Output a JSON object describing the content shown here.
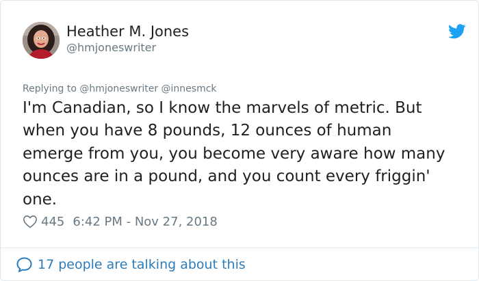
{
  "author": {
    "name": "Heather M. Jones",
    "handle": "@hmjoneswriter",
    "avatar_icon": "profile-photo"
  },
  "reply_context": "Replying to @hmjoneswriter @innesmck",
  "tweet": {
    "text": "I'm Canadian, so I know the marvels of metric. But when you have 8 pounds, 12 ounces of human emerge from you, you become very aware how many ounces are in a pound, and you count every friggin' one.",
    "likes": "445",
    "timestamp": "6:42 PM - Nov 27, 2018"
  },
  "footer": {
    "conversation": "17 people are talking about this"
  },
  "colors": {
    "twitter_blue": "#1da1f2",
    "link_blue": "#2b7bb9",
    "muted": "#697882",
    "text": "#1c2022",
    "border": "#e1e8ed"
  },
  "icons": {
    "brand": "twitter-bird-icon",
    "like": "heart-icon",
    "reply": "speech-bubble-icon"
  }
}
